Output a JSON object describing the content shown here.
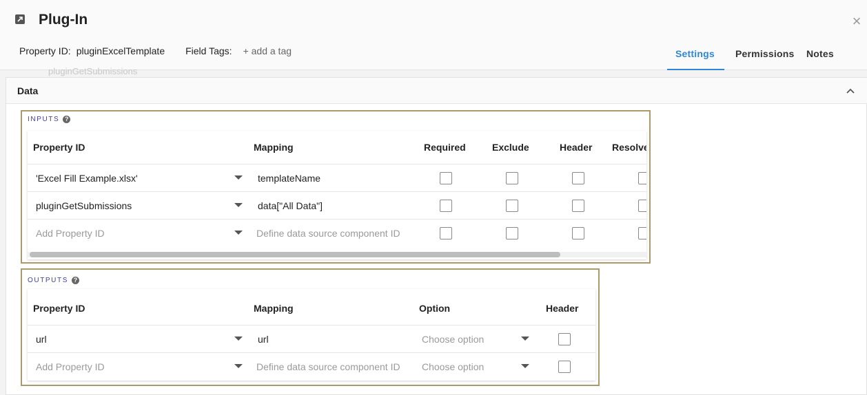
{
  "header": {
    "title": "Plug-In",
    "property_id_label": "Property ID:",
    "property_id_value": "pluginExcelTemplate",
    "field_tags_label": "Field Tags:",
    "add_tag": "+ add a tag",
    "close": "×"
  },
  "tabs": [
    {
      "label": "Settings",
      "active": true
    },
    {
      "label": "Permissions",
      "active": false
    },
    {
      "label": "Notes",
      "active": false
    }
  ],
  "ghost_text": "pluginGetSubmissions",
  "section": {
    "title": "Data"
  },
  "inputs": {
    "label": "INPUTS",
    "help": "?",
    "columns": [
      "Property ID",
      "Mapping",
      "Required",
      "Exclude",
      "Header",
      "Resolve"
    ],
    "rows": [
      {
        "property_id": "'Excel Fill Example.xlsx'",
        "mapping": "templateName",
        "placeholder": false
      },
      {
        "property_id": "pluginGetSubmissions",
        "mapping": "data[\"All Data\"]",
        "placeholder": false
      },
      {
        "property_id": "Add Property ID",
        "mapping": "Define data source component ID",
        "placeholder": true
      }
    ]
  },
  "outputs": {
    "label": "OUTPUTS",
    "help": "?",
    "columns": [
      "Property ID",
      "Mapping",
      "Option",
      "Header"
    ],
    "rows": [
      {
        "property_id": "url",
        "mapping": "url",
        "option": "Choose option",
        "placeholder": false
      },
      {
        "property_id": "Add Property ID",
        "mapping": "Define data source component ID",
        "option": "Choose option",
        "placeholder": true
      }
    ]
  },
  "colors": {
    "accent": "#2f86d6",
    "box_border": "#a99a67",
    "section_label": "#3b3fa0"
  }
}
